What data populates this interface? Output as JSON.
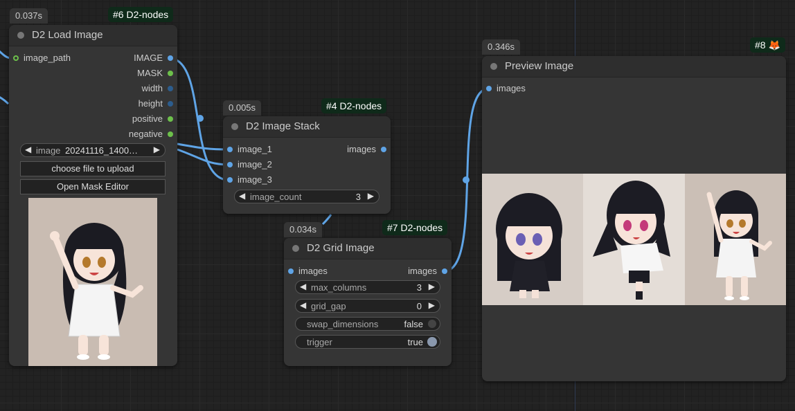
{
  "canvas": {
    "link_color": "#5fa4e6",
    "background": "#222222"
  },
  "nodes": {
    "load_image": {
      "id_badge": "#6 D2-nodes",
      "timing": "0.037s",
      "title": "D2 Load Image",
      "inputs": [
        {
          "label": "image_path",
          "type_color": "green-ring"
        }
      ],
      "outputs": [
        {
          "label": "IMAGE",
          "type_color": "blue"
        },
        {
          "label": "MASK",
          "type_color": "green"
        },
        {
          "label": "width",
          "type_color": "navy"
        },
        {
          "label": "height",
          "type_color": "navy"
        },
        {
          "label": "positive",
          "type_color": "green"
        },
        {
          "label": "negative",
          "type_color": "green"
        }
      ],
      "image_widget": {
        "name": "image",
        "value": "20241116_1400…"
      },
      "upload_button": "choose file to upload",
      "mask_button": "Open Mask Editor",
      "preview_icon": "character-standing-waving-image"
    },
    "image_stack": {
      "id_badge": "#4 D2-nodes",
      "timing": "0.005s",
      "title": "D2 Image Stack",
      "inputs": [
        {
          "label": "image_1",
          "type_color": "blue"
        },
        {
          "label": "image_2",
          "type_color": "blue"
        },
        {
          "label": "image_3",
          "type_color": "blue"
        }
      ],
      "outputs": [
        {
          "label": "images",
          "type_color": "blue"
        }
      ],
      "widgets": [
        {
          "name": "image_count",
          "value": "3"
        }
      ]
    },
    "grid_image": {
      "id_badge": "#7 D2-nodes",
      "timing": "0.034s",
      "title": "D2 Grid Image",
      "inputs": [
        {
          "label": "images",
          "type_color": "blue"
        }
      ],
      "outputs": [
        {
          "label": "images",
          "type_color": "blue"
        }
      ],
      "widgets": [
        {
          "name": "max_columns",
          "value": "3"
        },
        {
          "name": "grid_gap",
          "value": "0"
        }
      ],
      "toggles": [
        {
          "name": "swap_dimensions",
          "value": "false",
          "on": false
        },
        {
          "name": "trigger",
          "value": "true",
          "on": true
        }
      ]
    },
    "preview_image": {
      "id_badge": "#8 🦊",
      "timing": "0.346s",
      "title": "Preview Image",
      "inputs": [
        {
          "label": "images",
          "type_color": "blue"
        }
      ],
      "preview_icon": "three-character-grid-image"
    }
  }
}
